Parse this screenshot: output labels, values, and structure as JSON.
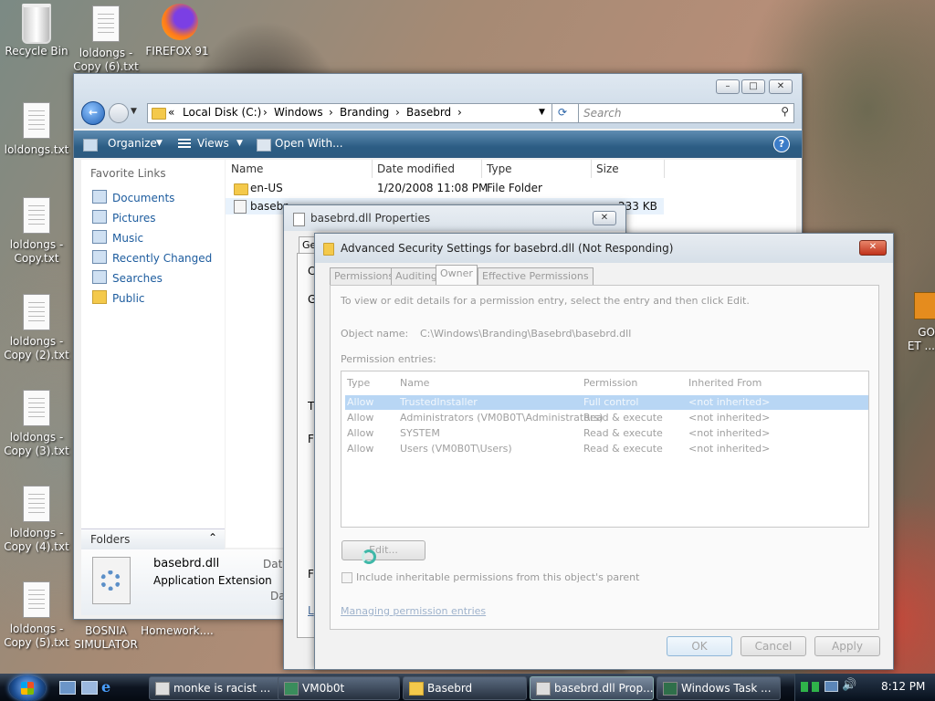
{
  "desktop_icons": [
    {
      "label": "Recycle Bin",
      "icon": "recycle-bin-icon"
    },
    {
      "label": "loldongs - Copy (6).txt",
      "icon": "text-file-icon"
    },
    {
      "label": "FIREFOX 91",
      "icon": "firefox-icon"
    },
    {
      "label": "loldongs.txt",
      "icon": "text-file-icon"
    },
    {
      "label": "loldongs - Copy.txt",
      "icon": "text-file-icon"
    },
    {
      "label": "loldongs - Copy (2).txt",
      "icon": "text-file-icon"
    },
    {
      "label": "loldongs - Copy (3).txt",
      "icon": "text-file-icon"
    },
    {
      "label": "loldongs - Copy (4).txt",
      "icon": "text-file-icon"
    },
    {
      "label": "loldongs - Copy (5).txt",
      "icon": "text-file-icon"
    },
    {
      "label": "BOSNIA SIMULATOR",
      "icon": "app-icon"
    },
    {
      "label": "Homework....",
      "icon": "app-icon"
    },
    {
      "label": "GO",
      "icon": "app-icon"
    },
    {
      "label": "ET ...",
      "icon": "app-icon"
    }
  ],
  "explorer": {
    "breadcrumb": [
      "«",
      "Local Disk (C:)",
      "Windows",
      "Branding",
      "Basebrd"
    ],
    "search_placeholder": "Search",
    "toolbar": {
      "organize": "Organize",
      "views": "Views",
      "open_with": "Open With..."
    },
    "favorite_links_header": "Favorite Links",
    "favorite_links": [
      "Documents",
      "Pictures",
      "Music",
      "Recently Changed",
      "Searches",
      "Public"
    ],
    "folders_label": "Folders",
    "columns": [
      "Name",
      "Date modified",
      "Type",
      "Size"
    ],
    "files": [
      {
        "name": "en-US",
        "date": "1/20/2008 11:08 PM",
        "type": "File Folder",
        "size": ""
      },
      {
        "name": "basebr",
        "date": "",
        "type": "",
        "size": "233 KB"
      }
    ],
    "details": {
      "filename": "basebrd.dll",
      "filetype": "Application Extension",
      "date_label": "Date",
      "date_label2": "Da"
    }
  },
  "properties": {
    "title": "basebrd.dll Properties",
    "tab_fragment": "Ge",
    "side_letters": [
      "C",
      "G",
      "T",
      "F",
      "F",
      "L"
    ]
  },
  "security": {
    "title": "Advanced Security Settings for basebrd.dll (Not Responding)",
    "tabs": [
      "Permissions",
      "Auditing",
      "Owner",
      "Effective Permissions"
    ],
    "instructions": "To view or edit details for a permission entry, select the entry and then click Edit.",
    "object_name_label": "Object name:",
    "object_name_value": "C:\\Windows\\Branding\\Basebrd\\basebrd.dll",
    "permission_entries_label": "Permission entries:",
    "table_headers": [
      "Type",
      "Name",
      "Permission",
      "Inherited From"
    ],
    "entries": [
      {
        "type": "Allow",
        "name": "TrustedInstaller",
        "permission": "Full control",
        "inherited": "<not inherited>"
      },
      {
        "type": "Allow",
        "name": "Administrators (VM0B0T\\Administrators)",
        "permission": "Read & execute",
        "inherited": "<not inherited>"
      },
      {
        "type": "Allow",
        "name": "SYSTEM",
        "permission": "Read & execute",
        "inherited": "<not inherited>"
      },
      {
        "type": "Allow",
        "name": "Users (VM0B0T\\Users)",
        "permission": "Read & execute",
        "inherited": "<not inherited>"
      }
    ],
    "edit_button": "Edit...",
    "include_inheritable": "Include inheritable permissions from this object's parent",
    "managing_link": "Managing permission entries",
    "ok": "OK",
    "cancel": "Cancel",
    "apply": "Apply"
  },
  "taskbar": {
    "items": [
      "monke is racist ...",
      "VM0b0t",
      "Basebrd",
      "basebrd.dll Prop...",
      "Windows Task ..."
    ],
    "clock": "8:12 PM"
  }
}
